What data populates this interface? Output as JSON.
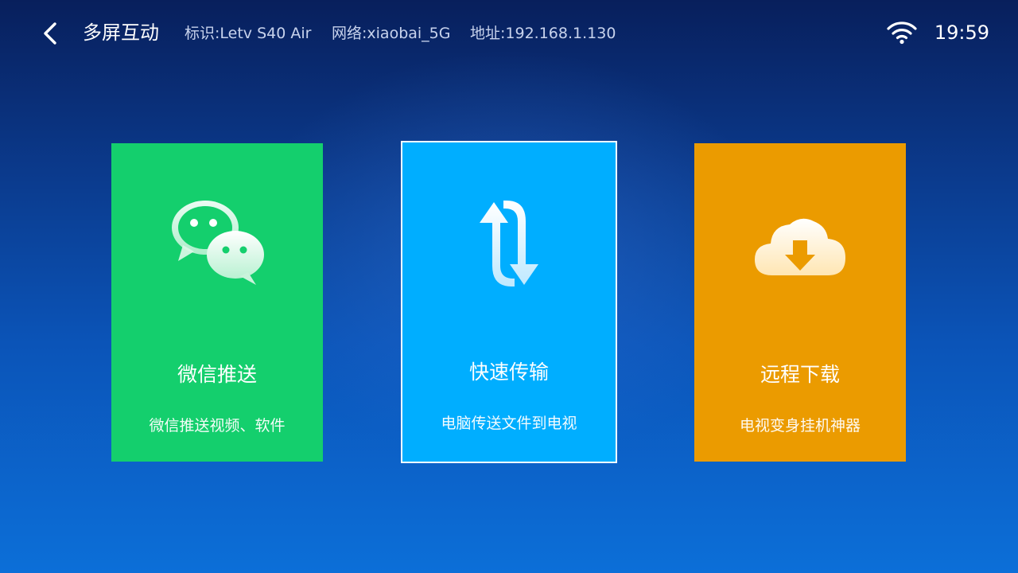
{
  "header": {
    "title": "多屏互动",
    "device_id": "标识:Letv S40 Air",
    "network": "网络:xiaobai_5G",
    "address": "地址:192.168.1.130",
    "time": "19:59",
    "icons": {
      "back": "chevron-left-icon",
      "wifi": "wifi-icon"
    }
  },
  "cards": [
    {
      "title": "微信推送",
      "desc": "微信推送视频、软件",
      "icon": "wechat-icon",
      "color": "#14cf6d"
    },
    {
      "title": "快速传输",
      "desc": "电脑传送文件到电视",
      "icon": "sync-arrows-icon",
      "color": "#00aeff",
      "focused": true
    },
    {
      "title": "远程下载",
      "desc": "电视变身挂机神器",
      "icon": "cloud-download-icon",
      "color": "#eb9b00"
    }
  ]
}
